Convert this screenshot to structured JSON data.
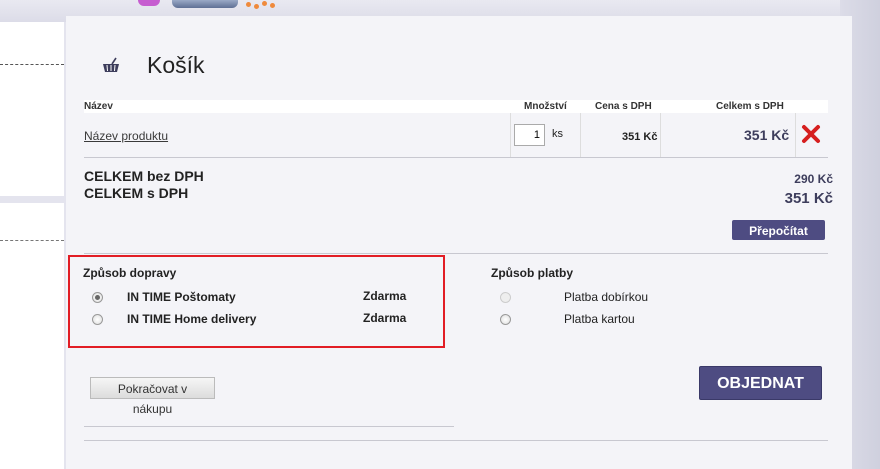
{
  "cart": {
    "title": "Košík",
    "columns": {
      "name": "Název",
      "quantity": "Množství",
      "unit_price": "Cena s DPH",
      "total": "Celkem s DPH"
    },
    "items": [
      {
        "name": "Název produktu",
        "quantity": "1",
        "unit": "ks",
        "unit_price": "351 Kč",
        "total": "351 Kč"
      }
    ],
    "summary": {
      "net_label": "CELKEM bez DPH",
      "gross_label": "CELKEM s DPH",
      "net_value": "290 Kč",
      "gross_value": "351 Kč"
    },
    "recalc_label": "Přepočítat"
  },
  "shipping": {
    "title": "Způsob dopravy",
    "options": [
      {
        "label": "IN TIME Poštomaty",
        "price": "Zdarma",
        "selected": true
      },
      {
        "label": "IN TIME Home delivery",
        "price": "Zdarma",
        "selected": false
      }
    ]
  },
  "payment": {
    "title": "Způsob platby",
    "options": [
      {
        "label": "Platba dobírkou",
        "disabled": true
      },
      {
        "label": "Platba kartou",
        "disabled": false
      }
    ]
  },
  "actions": {
    "continue_label": "Pokračovat v nákupu",
    "order_label": "OBJEDNAT"
  },
  "colors": {
    "accent": "#4e4c82",
    "highlight_border": "#e21d25",
    "remove_icon": "#d61f1f"
  }
}
